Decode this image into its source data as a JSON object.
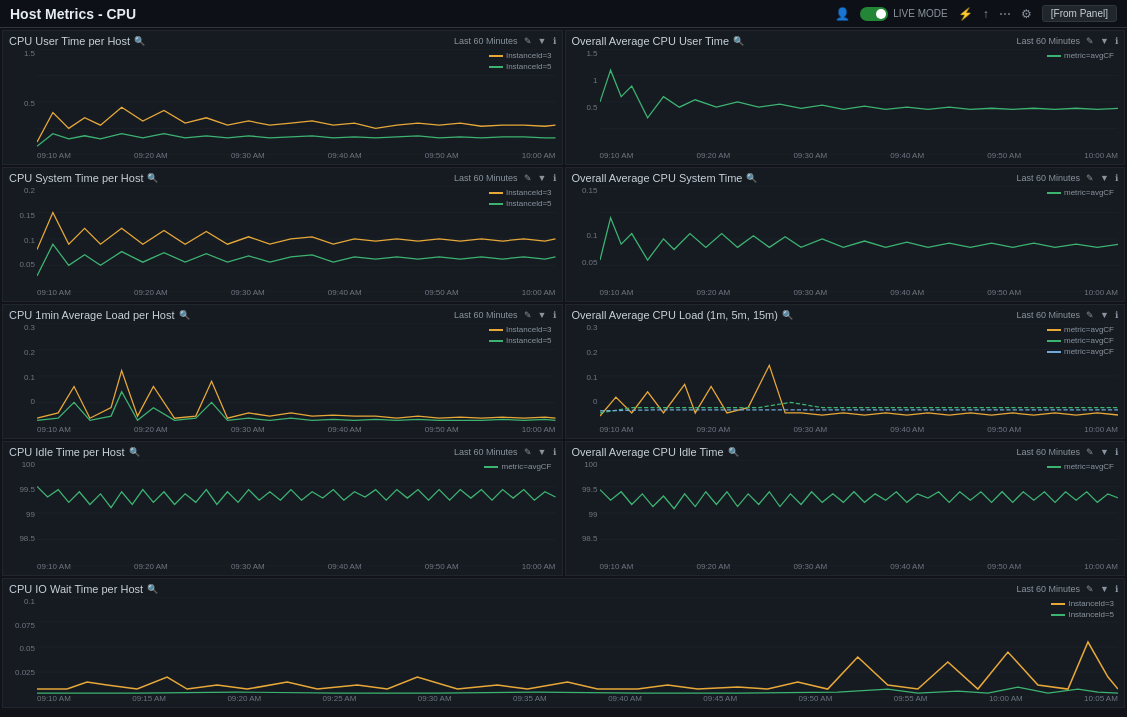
{
  "topBar": {
    "title": "Host Metrics - CPU",
    "liveMode": "LIVE MODE",
    "fromPanel": "[From Panel]",
    "userIcon": "👤",
    "filterIcon": "⚡",
    "shareIcon": "↑",
    "dotsIcon": "⋯",
    "settingsIcon": "⚙"
  },
  "timeLabel": "Last 60 Minutes",
  "xLabels": [
    "09:10 AM",
    "09:20 AM",
    "09:30 AM",
    "09:40 AM",
    "09:50 AM",
    "10:00 AM"
  ],
  "xLabelsWide": [
    "09:10 AM",
    "09:15 AM",
    "09:20 AM",
    "09:25 AM",
    "09:30 AM",
    "09:35 AM",
    "09:40 AM",
    "09:45 AM",
    "09:50 AM",
    "09:55 AM",
    "10:00 AM",
    "10:05 AM"
  ],
  "panels": [
    {
      "id": "cpu-user-per-host",
      "title": "CPU User Time per Host",
      "legend": [
        {
          "label": "Instanceld=3",
          "color": "#e8a838"
        },
        {
          "label": "Instanceld=5",
          "color": "#3cb371"
        }
      ],
      "yLabels": [
        "1.5",
        "",
        "0.5",
        "",
        ""
      ],
      "type": "multi"
    },
    {
      "id": "overall-avg-cpu-user",
      "title": "Overall Average CPU User Time",
      "legend": [
        {
          "label": "metric=avgCF",
          "color": "#3cb371"
        }
      ],
      "yLabels": [
        "1.5",
        "1",
        "0.5",
        "",
        ""
      ],
      "type": "single"
    },
    {
      "id": "cpu-system-per-host",
      "title": "CPU System Time per Host",
      "legend": [
        {
          "label": "Instanceld=3",
          "color": "#e8a838"
        },
        {
          "label": "Instanceld=5",
          "color": "#3cb371"
        }
      ],
      "yLabels": [
        "0.2",
        "0.15",
        "0.1",
        "0.05",
        ""
      ],
      "type": "multi"
    },
    {
      "id": "overall-avg-cpu-system",
      "title": "Overall Average CPU System Time",
      "legend": [
        {
          "label": "metric=avgCF",
          "color": "#3cb371"
        }
      ],
      "yLabels": [
        "0.15",
        "",
        "0.1",
        "0.05",
        ""
      ],
      "type": "single"
    },
    {
      "id": "cpu-1min-load-per-host",
      "title": "CPU 1min Average Load per Host",
      "legend": [
        {
          "label": "Instanceld=3",
          "color": "#e8a838"
        },
        {
          "label": "Instanceld=5",
          "color": "#3cb371"
        }
      ],
      "yLabels": [
        "0.3",
        "0.2",
        "0.1",
        "0",
        ""
      ],
      "type": "multi"
    },
    {
      "id": "overall-avg-cpu-load",
      "title": "Overall Average CPU Load (1m, 5m, 15m)",
      "legend": [
        {
          "label": "metric=avgCF",
          "color": "#e8a838"
        },
        {
          "label": "metric=avgCF",
          "color": "#3cb371"
        },
        {
          "label": "metric=avgCF",
          "color": "#6ea8d8"
        }
      ],
      "yLabels": [
        "0.3",
        "0.2",
        "0.1",
        "0",
        ""
      ],
      "type": "multi3"
    },
    {
      "id": "cpu-idle-per-host",
      "title": "CPU Idle Time per Host",
      "legend": [
        {
          "label": "metric=avgCF",
          "color": "#3cb371"
        }
      ],
      "yLabels": [
        "100",
        "99.5",
        "99",
        "98.5",
        ""
      ],
      "type": "single-idle"
    },
    {
      "id": "overall-avg-cpu-idle",
      "title": "Overall Average CPU Idle Time",
      "legend": [
        {
          "label": "metric=avgCF",
          "color": "#3cb371"
        }
      ],
      "yLabels": [
        "100",
        "99.5",
        "99",
        "98.5",
        ""
      ],
      "type": "single-idle"
    },
    {
      "id": "cpu-io-wait-per-host",
      "title": "CPU IO Wait Time per Host",
      "legend": [
        {
          "label": "Instanceld=3",
          "color": "#e8a838"
        },
        {
          "label": "Instanceld=5",
          "color": "#3cb371"
        }
      ],
      "yLabels": [
        "0.1",
        "0.075",
        "0.05",
        "0.025",
        ""
      ],
      "type": "multi-wide",
      "fullWidth": true
    }
  ],
  "colors": {
    "teal": "#3cb371",
    "orange": "#e8a838",
    "blue": "#6ea8d8",
    "bg": "#161b22",
    "border": "#21262d",
    "grid": "#21262d",
    "text": "#c9d1d9",
    "subtext": "#8b949e"
  }
}
